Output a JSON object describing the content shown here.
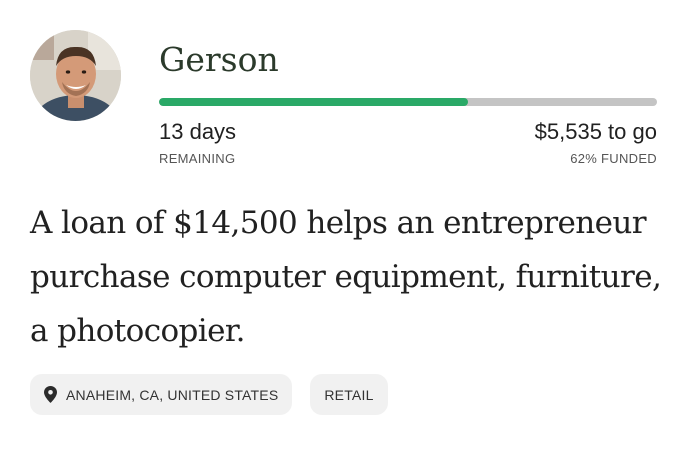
{
  "borrower": {
    "name": "Gerson"
  },
  "progress": {
    "funded_fraction": 0.62,
    "fill_color": "#2aa967",
    "track_color": "#c4c4c4"
  },
  "stats": {
    "days": "13 days",
    "days_caption": "REMAINING",
    "to_go": "$5,535 to go",
    "funded_caption": "62% FUNDED"
  },
  "loan": {
    "description": "A loan of $14,500 helps an entrepreneur purchase computer equipment, furniture, a photocopier."
  },
  "tags": {
    "location": {
      "icon": "location-pin-icon",
      "label": "ANAHEIM, CA, UNITED STATES"
    },
    "sector": {
      "label": "RETAIL"
    }
  }
}
